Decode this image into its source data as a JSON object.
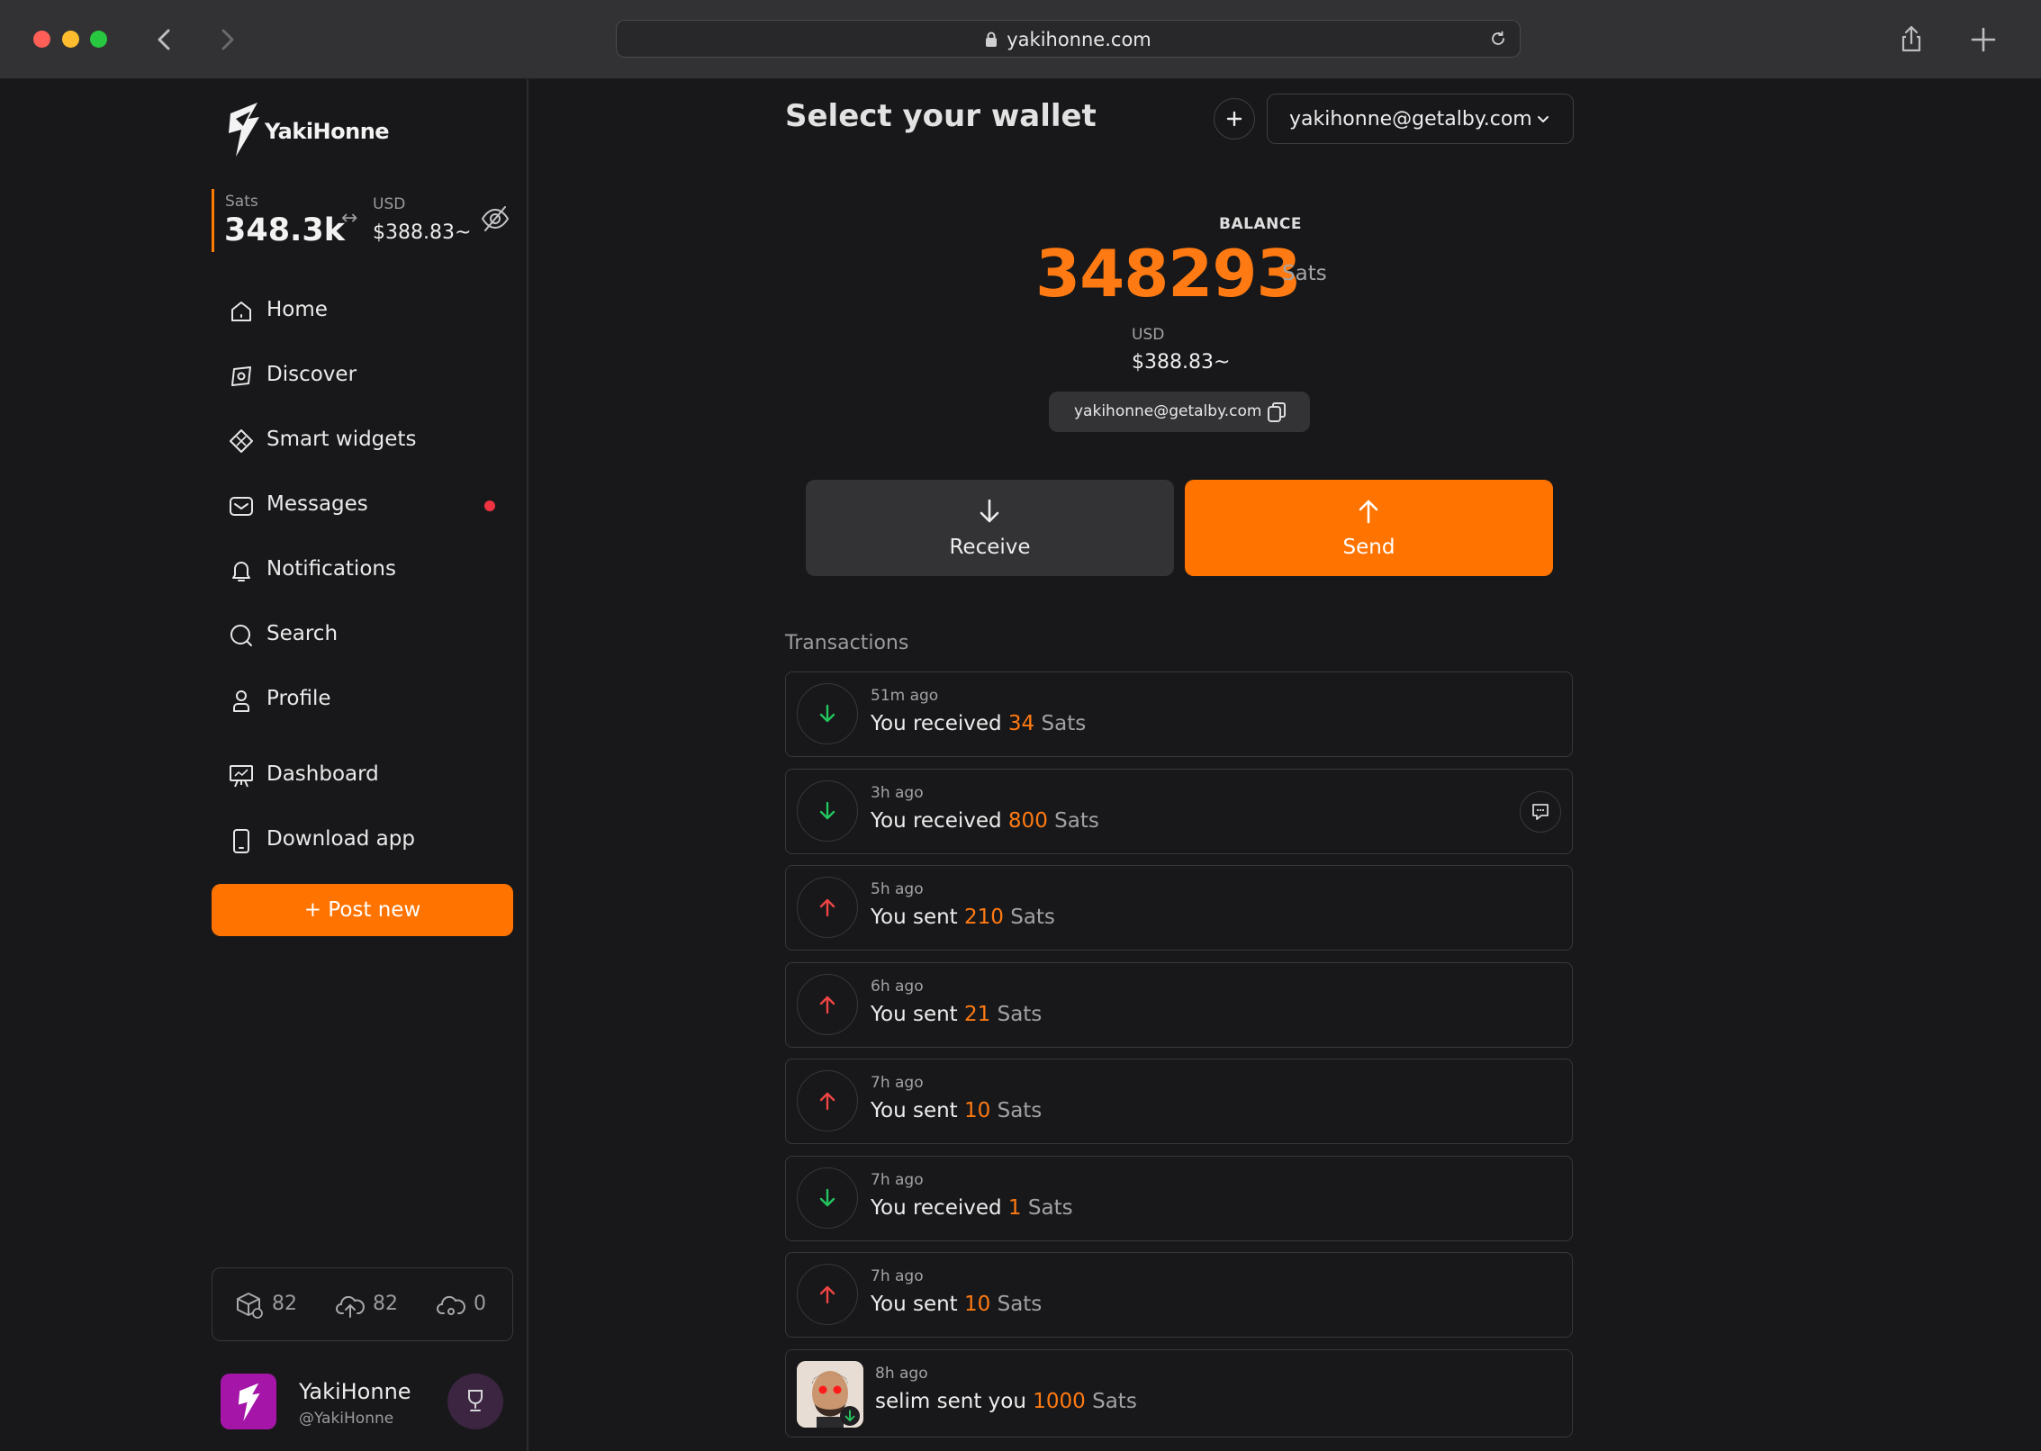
{
  "browser": {
    "url": "yakihonne.com"
  },
  "sidebar": {
    "logo_text": "YakiHonne",
    "balance": {
      "sats_label": "Sats",
      "sats_value": "348.3k",
      "swap_glyph": "↔",
      "usd_label": "USD",
      "usd_value": "$388.83~"
    },
    "nav": [
      {
        "label": "Home",
        "icon": "home-icon"
      },
      {
        "label": "Discover",
        "icon": "compass-icon"
      },
      {
        "label": "Smart widgets",
        "icon": "widgets-icon"
      },
      {
        "label": "Messages",
        "icon": "mail-icon",
        "badge": true
      },
      {
        "label": "Notifications",
        "icon": "bell-icon"
      },
      {
        "label": "Search",
        "icon": "search-icon"
      },
      {
        "label": "Profile",
        "icon": "user-icon"
      },
      {
        "label": "Dashboard",
        "icon": "dashboard-icon"
      },
      {
        "label": "Download app",
        "icon": "phone-icon"
      }
    ],
    "post_button": "+ Post new",
    "stats": [
      {
        "icon": "cache-icon",
        "value": "82"
      },
      {
        "icon": "cloud-upload-icon",
        "value": "82"
      },
      {
        "icon": "cloud-pending-icon",
        "value": "0"
      }
    ],
    "profile": {
      "name": "YakiHonne",
      "handle": "@YakiHonne"
    }
  },
  "main": {
    "title": "Select your wallet",
    "wallet_selected": "yakihonne@getalby.com",
    "balance_label": "BALANCE",
    "balance_amount": "348293",
    "balance_unit": "Sats",
    "usd_label": "USD",
    "usd_amount": "$388.83~",
    "address": "yakihonne@getalby.com",
    "receive_label": "Receive",
    "send_label": "Send",
    "transactions_title": "Transactions",
    "transactions": [
      {
        "time": "51m ago",
        "prefix": "You received ",
        "amount": "34",
        "unit": " Sats",
        "direction": "in"
      },
      {
        "time": "3h ago",
        "prefix": "You received ",
        "amount": "800",
        "unit": " Sats",
        "direction": "in",
        "has_comment": true
      },
      {
        "time": "5h ago",
        "prefix": "You sent ",
        "amount": "210",
        "unit": " Sats",
        "direction": "out"
      },
      {
        "time": "6h ago",
        "prefix": "You sent ",
        "amount": "21",
        "unit": " Sats",
        "direction": "out"
      },
      {
        "time": "7h ago",
        "prefix": "You sent ",
        "amount": "10",
        "unit": " Sats",
        "direction": "out"
      },
      {
        "time": "7h ago",
        "prefix": "You received ",
        "amount": "1",
        "unit": " Sats",
        "direction": "in"
      },
      {
        "time": "7h ago",
        "prefix": "You sent ",
        "amount": "10",
        "unit": " Sats",
        "direction": "out"
      },
      {
        "time": "8h ago",
        "prefix": "selim sent you ",
        "amount": "1000",
        "unit": " Sats",
        "direction": "in",
        "avatar": true
      }
    ]
  },
  "colors": {
    "accent": "#ff7300",
    "received": "#22c55e",
    "sent": "#ef4444",
    "badge": "#ef3340"
  }
}
